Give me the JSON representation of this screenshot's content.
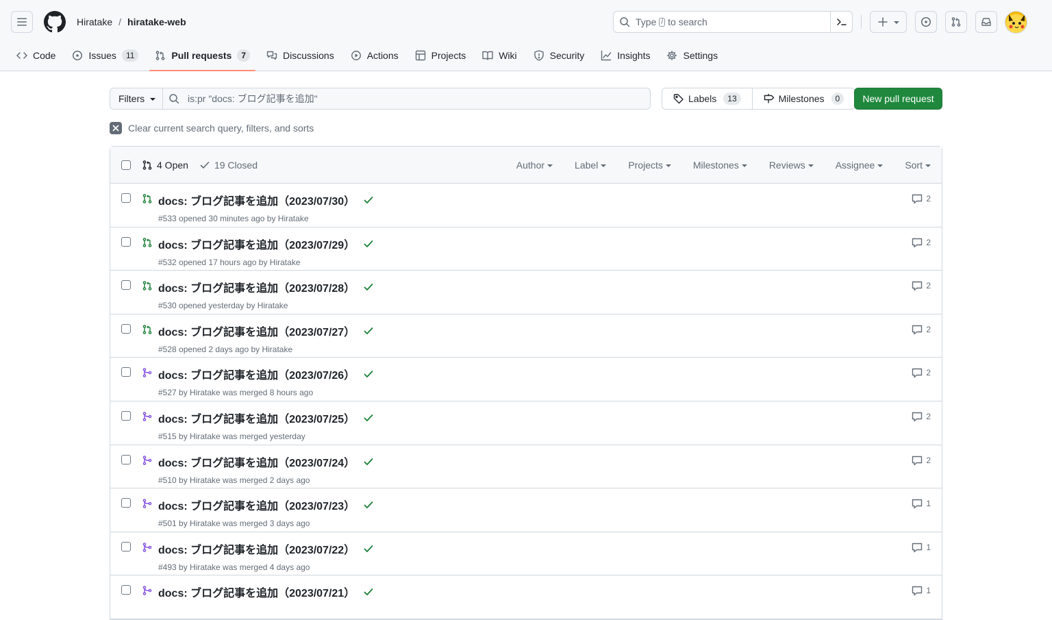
{
  "header": {
    "owner": "Hiratake",
    "separator": "/",
    "repo": "hiratake-web",
    "search": {
      "prefix": "Type",
      "key": "/",
      "suffix": "to search"
    }
  },
  "tabs": [
    {
      "label": "Code"
    },
    {
      "label": "Issues",
      "count": "11"
    },
    {
      "label": "Pull requests",
      "count": "7"
    },
    {
      "label": "Discussions"
    },
    {
      "label": "Actions"
    },
    {
      "label": "Projects"
    },
    {
      "label": "Wiki"
    },
    {
      "label": "Security"
    },
    {
      "label": "Insights"
    },
    {
      "label": "Settings"
    }
  ],
  "toolbar": {
    "filters_label": "Filters",
    "query": "is:pr \"docs: ブログ記事を追加\"",
    "labels_label": "Labels",
    "labels_count": "13",
    "milestones_label": "Milestones",
    "milestones_count": "0",
    "new_pr_label": "New pull request"
  },
  "clear_text": "Clear current search query, filters, and sorts",
  "list": {
    "open_label": "4 Open",
    "closed_label": "19 Closed",
    "filters": [
      "Author",
      "Label",
      "Projects",
      "Milestones",
      "Reviews",
      "Assignee",
      "Sort"
    ],
    "rows": [
      {
        "title": "docs: ブログ記事を追加（2023/07/30）",
        "meta": "#533 opened 30 minutes ago by Hiratake",
        "comments": "2",
        "state": "open"
      },
      {
        "title": "docs: ブログ記事を追加（2023/07/29）",
        "meta": "#532 opened 17 hours ago by Hiratake",
        "comments": "2",
        "state": "open"
      },
      {
        "title": "docs: ブログ記事を追加（2023/07/28）",
        "meta": "#530 opened yesterday by Hiratake",
        "comments": "2",
        "state": "open"
      },
      {
        "title": "docs: ブログ記事を追加（2023/07/27）",
        "meta": "#528 opened 2 days ago by Hiratake",
        "comments": "2",
        "state": "open"
      },
      {
        "title": "docs: ブログ記事を追加（2023/07/26）",
        "meta": "#527 by Hiratake was merged 8 hours ago",
        "comments": "2",
        "state": "merged"
      },
      {
        "title": "docs: ブログ記事を追加（2023/07/25）",
        "meta": "#515 by Hiratake was merged yesterday",
        "comments": "2",
        "state": "merged"
      },
      {
        "title": "docs: ブログ記事を追加（2023/07/24）",
        "meta": "#510 by Hiratake was merged 2 days ago",
        "comments": "2",
        "state": "merged"
      },
      {
        "title": "docs: ブログ記事を追加（2023/07/23）",
        "meta": "#501 by Hiratake was merged 3 days ago",
        "comments": "1",
        "state": "merged"
      },
      {
        "title": "docs: ブログ記事を追加（2023/07/22）",
        "meta": "#493 by Hiratake was merged 4 days ago",
        "comments": "1",
        "state": "merged"
      },
      {
        "title": "docs: ブログ記事を追加（2023/07/21）",
        "meta": "",
        "comments": "1",
        "state": "merged"
      }
    ]
  },
  "colors": {
    "open": "#1a7f37",
    "merged": "#8250df",
    "primary_button": "#1f883d",
    "tab_underline": "#fd8c73"
  }
}
